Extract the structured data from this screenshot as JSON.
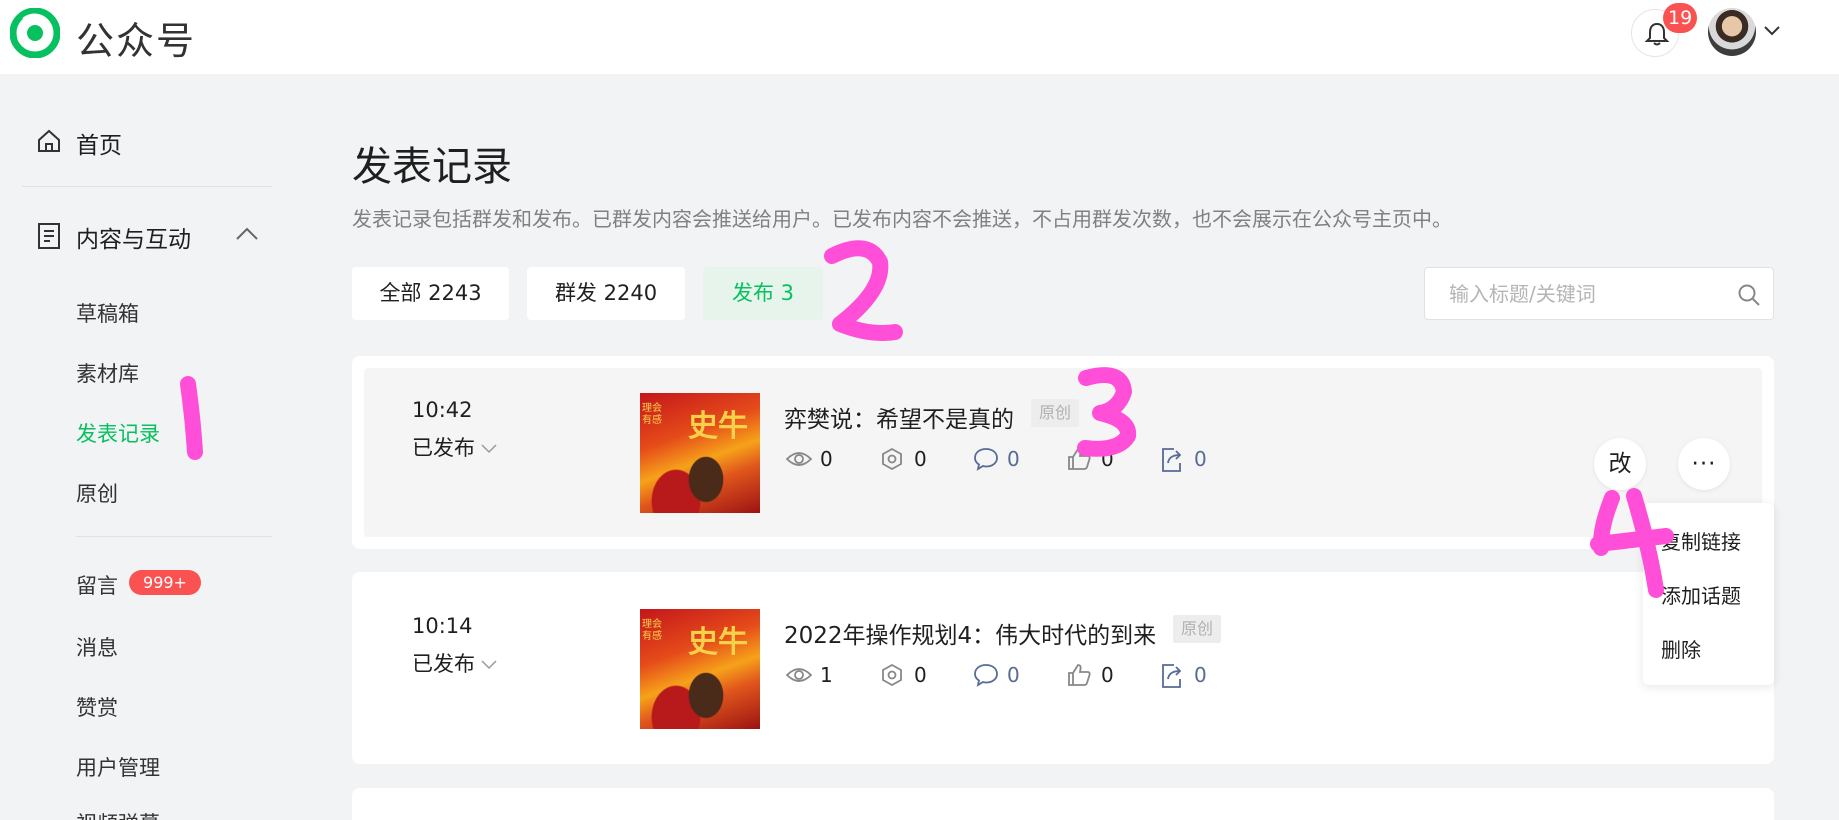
{
  "header": {
    "brand": "公众号",
    "notification_count": "19",
    "logo_icon": "wechat-logo-icon",
    "bell_icon": "bell-icon"
  },
  "sidebar": {
    "home": "首页",
    "content_section": "内容与互动",
    "sub_items": [
      "草稿箱",
      "素材库",
      "发表记录",
      "原创"
    ],
    "active_item": "发表记录",
    "messages": "留言",
    "messages_badge": "999+",
    "other_items": [
      "消息",
      "赞赏",
      "用户管理",
      "视频弹幕"
    ]
  },
  "main": {
    "title": "发表记录",
    "description": "发表记录包括群发和发布。已群发内容会推送给用户。已发布内容不会推送，不占用群发次数，也不会展示在公众号主页中。",
    "tabs": [
      {
        "label": "全部 2243"
      },
      {
        "label": "群发 2240"
      },
      {
        "label": "发布 3",
        "active": true
      }
    ],
    "search_placeholder": "输入标题/关键词"
  },
  "articles": [
    {
      "time": "10:42",
      "status": "已发布",
      "title": "弈樊说：希望不是真的",
      "tag": "原创",
      "thumb_text": "史牛",
      "thumb_small": "理会\n有感",
      "stats": {
        "views": "0",
        "shares": "0",
        "comments": "0",
        "likes": "0",
        "forwards": "0"
      }
    },
    {
      "time": "10:14",
      "status": "已发布",
      "title": "2022年操作规划4：伟大时代的到来",
      "tag": "原创",
      "thumb_text": "史牛",
      "thumb_small": "理会\n有感",
      "stats": {
        "views": "1",
        "shares": "0",
        "comments": "0",
        "likes": "0",
        "forwards": "0"
      }
    }
  ],
  "actions": {
    "edit_label": "改",
    "more_label": "···"
  },
  "context_menu": [
    "复制链接",
    "添加话题",
    "删除"
  ],
  "annotations": [
    "1",
    "2",
    "3",
    "4"
  ],
  "colors": {
    "accent": "#07c160",
    "badge": "#fa5151",
    "stat_blue": "#576b95",
    "annotation": "#ff4fd8"
  }
}
